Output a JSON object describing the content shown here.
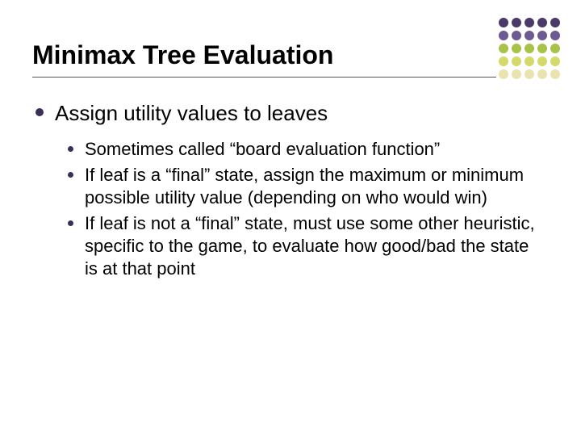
{
  "title": "Minimax Tree Evaluation",
  "bullets": {
    "main": "Assign utility values to leaves",
    "sub": [
      "Sometimes called “board evaluation function”",
      "If leaf is a “final” state, assign the maximum or minimum possible utility value (depending on who would win)",
      "If leaf is not a “final” state, must use some other heuristic, specific to the game, to evaluate how good/bad the state is at that point"
    ]
  },
  "decor": {
    "dot_colors": [
      "#4a3a68",
      "#4a3a68",
      "#4a3a68",
      "#4a3a68",
      "#4a3a68",
      "#6d5a93",
      "#6d5a93",
      "#6d5a93",
      "#6d5a93",
      "#6d5a93",
      "#a9c24a",
      "#a9c24a",
      "#a9c24a",
      "#a9c24a",
      "#a9c24a",
      "#d3d96a",
      "#d3d96a",
      "#d3d96a",
      "#d3d96a",
      "#d3d96a",
      "#e9e3b0",
      "#e9e3b0",
      "#e9e3b0",
      "#e9e3b0",
      "#e9e3b0"
    ]
  }
}
